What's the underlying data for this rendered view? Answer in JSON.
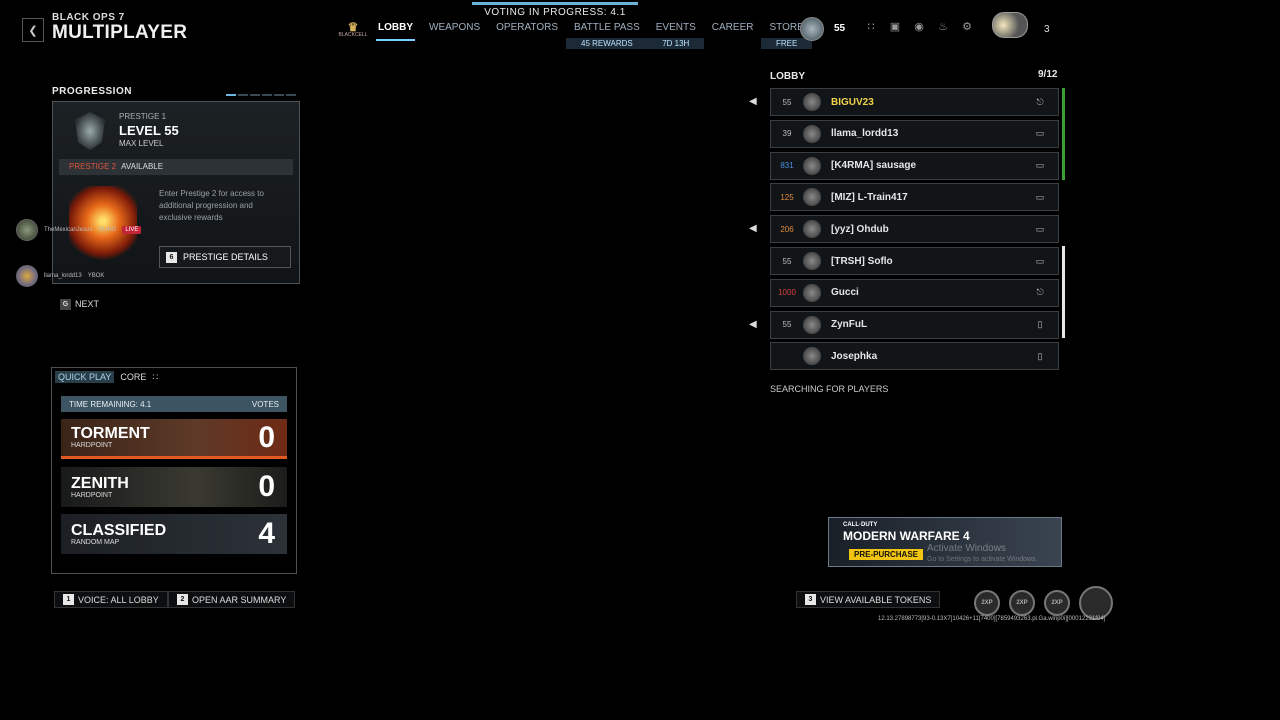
{
  "header": {
    "back_icon": "chevron-left-icon",
    "game_logo": "BLACK OPS 7",
    "title": "MULTIPLAYER",
    "voting_banner": "VOTING IN PROGRESS: 4.1",
    "nav_logo": "BLACKCELL",
    "nav": [
      {
        "label": "LOBBY",
        "sub": ""
      },
      {
        "label": "WEAPONS",
        "sub": ""
      },
      {
        "label": "OPERATORS",
        "sub": ""
      },
      {
        "label": "BATTLE PASS",
        "sub": "45 REWARDS"
      },
      {
        "label": "EVENTS",
        "sub": "7D 13H"
      },
      {
        "label": "CAREER",
        "sub": ""
      },
      {
        "label": "STORE",
        "sub": "FREE"
      }
    ],
    "user_level": "55",
    "friends_count": "3"
  },
  "progression": {
    "title": "PROGRESSION",
    "prestige": "PRESTIGE 1",
    "level": "LEVEL 55",
    "max_level": "MAX LEVEL",
    "next_prestige": "PRESTIGE 2",
    "available": "AVAILABLE",
    "description": "Enter Prestige 2 for access to additional progression and exclusive rewards",
    "details_key": "6",
    "details_label": "PRESTIGE DETAILS"
  },
  "party": [
    {
      "name": "TheMexicanJesus",
      "tag": "GUNG",
      "live": "LIVE"
    },
    {
      "name": "llama_lordd13",
      "tag": "YBOK"
    }
  ],
  "next": {
    "key": "G",
    "label": "NEXT"
  },
  "quickplay": {
    "tab_quickplay": "QUICK PLAY",
    "tab_core": "CORE",
    "time_remaining": "TIME REMAINING: 4.1",
    "votes_label": "VOTES",
    "maps": [
      {
        "name": "TORMENT",
        "mode": "HARDPOINT",
        "votes": "0"
      },
      {
        "name": "ZENITH",
        "mode": "HARDPOINT",
        "votes": "0"
      },
      {
        "name": "CLASSIFIED",
        "mode": "RANDOM MAP",
        "votes": "4"
      }
    ]
  },
  "bottom": {
    "voice_key": "1",
    "voice_label": "VOICE: ALL LOBBY",
    "aar_key": "2",
    "aar_label": "OPEN AAR SUMMARY",
    "tokens_key": "3",
    "tokens_label": "VIEW AVAILABLE TOKENS",
    "token_icon_label": "2XP",
    "build": "12.13.27898773[93-0.13X7]10426+11[7400][7859493263.pl.Ga.winp0i][00012231f04]"
  },
  "lobby": {
    "title": "LOBBY",
    "count": "9/12",
    "players": [
      {
        "level": "55",
        "name": "BIGUV23",
        "platform": "xbox-icon",
        "speaker": true
      },
      {
        "level": "39",
        "name": "llama_lordd13",
        "platform": "pc-icon",
        "speaker": false
      },
      {
        "level": "831",
        "name": "[K4RMA] sausage",
        "platform": "pc-icon",
        "speaker": false
      },
      {
        "level": "125",
        "name": "[MIZ] L-Train417",
        "platform": "pc-icon",
        "speaker": false
      },
      {
        "level": "206",
        "name": "[yyz] Ohdub",
        "platform": "pc-icon",
        "speaker": true
      },
      {
        "level": "55",
        "name": "[TRSH] Soflo",
        "platform": "pc-icon",
        "speaker": false
      },
      {
        "level": "1000",
        "name": "Gucci",
        "platform": "xbox-icon",
        "speaker": false
      },
      {
        "level": "55",
        "name": "ZynFuL",
        "platform": "phone-icon",
        "speaker": true
      },
      {
        "level": "",
        "name": "Josephka",
        "platform": "phone-icon",
        "speaker": false
      }
    ],
    "searching": "SEARCHING FOR PLAYERS"
  },
  "ad": {
    "brand": "CALL·DUTY",
    "title": "MODERN WARFARE 4",
    "cta": "PRE-PURCHASE",
    "watermark": "Activate Windows",
    "watermark_sub": "Go to Settings to activate Windows."
  },
  "colors": {
    "accent": "#7ad0ff",
    "vote_highlight": "#e05a22",
    "live": "#c4243a",
    "highlight_name": "#f1d24a"
  }
}
